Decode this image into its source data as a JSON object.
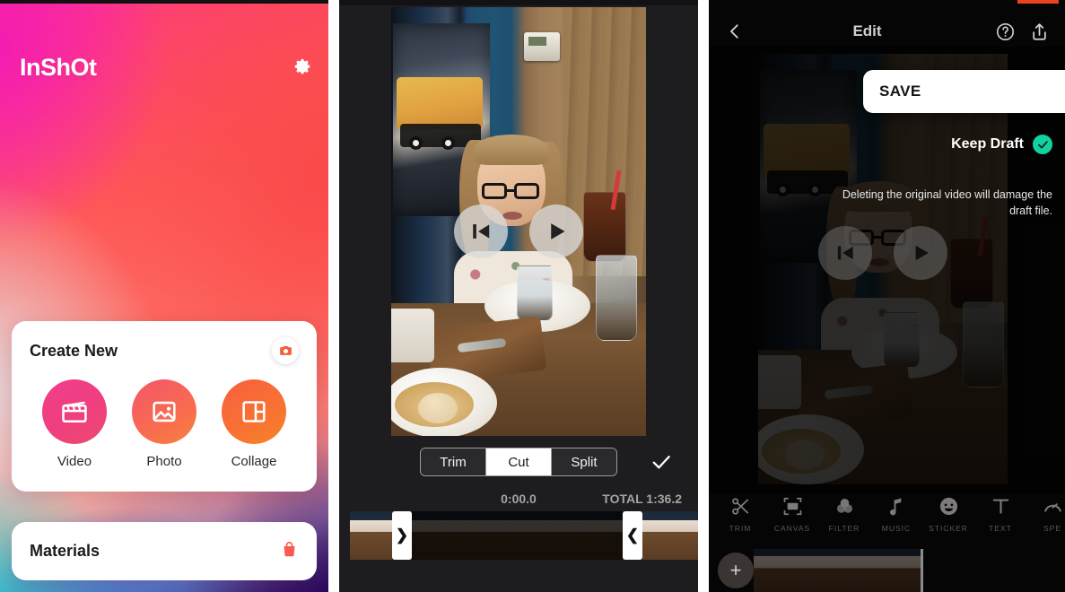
{
  "panel1": {
    "name": "inshot-home",
    "app_logo": "InShOt",
    "settings_icon": "gear-icon",
    "create_card": {
      "title": "Create New",
      "camera_icon": "camera-icon",
      "tiles": [
        {
          "label": "Video",
          "icon": "clapperboard-icon",
          "color": "#f23d8c"
        },
        {
          "label": "Photo",
          "icon": "image-icon",
          "color": "#f86c4f"
        },
        {
          "label": "Collage",
          "icon": "collage-icon",
          "color": "#f87233"
        }
      ]
    },
    "materials_card": {
      "title": "Materials",
      "icon": "shopping-bag-icon"
    }
  },
  "panel2": {
    "name": "video-editor-cut",
    "play_controls": {
      "rewind_icon": "skip-back-icon",
      "play_icon": "play-icon"
    },
    "segments": [
      {
        "label": "Trim",
        "selected": false
      },
      {
        "label": "Cut",
        "selected": true
      },
      {
        "label": "Split",
        "selected": false
      }
    ],
    "confirm_icon": "check-icon",
    "timecodes": {
      "current": "0:00.0",
      "total": "TOTAL 1:36.2"
    },
    "timeline": {
      "left_handle": "❯",
      "right_handle": "❮"
    }
  },
  "panel3": {
    "name": "edit-save-draft",
    "header": {
      "back_icon": "chevron-left-icon",
      "title": "Edit",
      "help_icon": "question-circle-icon",
      "share_icon": "share-upload-icon"
    },
    "play_controls": {
      "rewind_icon": "skip-back-icon",
      "play_icon": "play-icon"
    },
    "save_dialog": {
      "save_label": "SAVE",
      "keep_draft_label": "Keep Draft",
      "keep_draft_checked_icon": "check-circle-icon",
      "keep_draft_color": "#12d2a0",
      "warning": "Deleting the original video will damage the draft file."
    },
    "tools": [
      {
        "label": "TRIM",
        "icon": "scissors-icon"
      },
      {
        "label": "CANVAS",
        "icon": "canvas-icon"
      },
      {
        "label": "FILTER",
        "icon": "filter-circles-icon"
      },
      {
        "label": "MUSIC",
        "icon": "music-note-icon"
      },
      {
        "label": "STICKER",
        "icon": "smiley-icon"
      },
      {
        "label": "TEXT",
        "icon": "text-t-icon"
      },
      {
        "label": "SPE",
        "icon": "speed-gauge-icon"
      }
    ],
    "add_clip_icon": "plus-icon"
  }
}
